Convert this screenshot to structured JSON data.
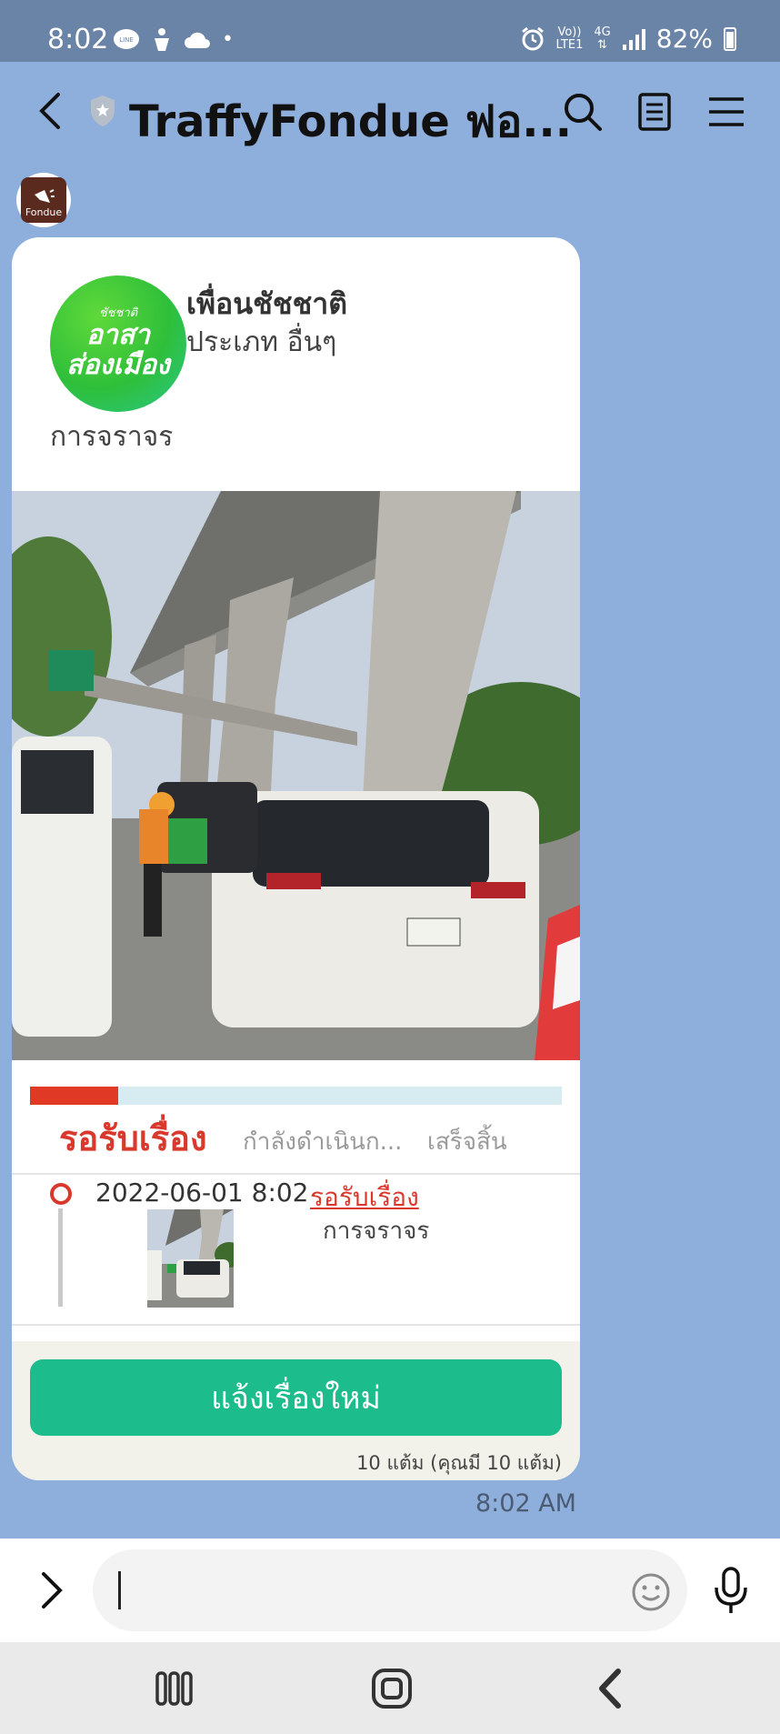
{
  "status_bar": {
    "time": "8:02",
    "line_badge": "LINE",
    "network_top": "Vo))",
    "network_bottom": "LTE1",
    "network_type": "4G",
    "battery": "82%"
  },
  "header": {
    "title": "TraffyFondue ฟอ..."
  },
  "bot_avatar": {
    "label": "Fondue"
  },
  "card": {
    "logo_lines": [
      "ชัชชาติ",
      "อาสา",
      "ส่องเมือง"
    ],
    "reporter": "เพื่อนชัชชาติ",
    "category": "ประเภท อื่นๆ",
    "topic": "การจราจร",
    "progress_fraction": 0.165,
    "stages": [
      "รอรับเรื่อง",
      "กำลังดำเนินก...",
      "เสร็จสิ้น"
    ],
    "timeline": {
      "date": "2022-06-01 8:02",
      "status": "รอรับเรื่อง",
      "topic": "การจราจร"
    },
    "new_report_button": "แจ้งเรื่องใหม่",
    "points": "10 แต้ม (คุณมี 10 แต้ม)"
  },
  "message_time": "8:02 AM",
  "input": {
    "placeholder": ""
  },
  "icons": {
    "back": "chevron-left-icon",
    "search": "search-icon",
    "notes": "notes-icon",
    "menu": "menu-icon",
    "emoji": "emoji-icon",
    "mic": "microphone-icon"
  },
  "colors": {
    "chat_bg": "#8eaedb",
    "accent_red": "#d8392c",
    "button_green": "#1cbc8c"
  }
}
